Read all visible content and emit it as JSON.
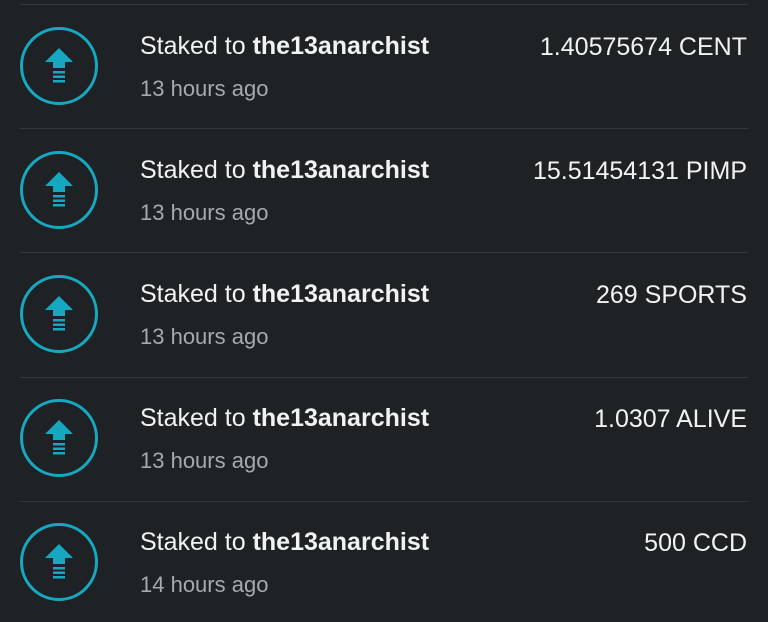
{
  "accent_color": "#17a7c0",
  "transactions": [
    {
      "action": "Staked to ",
      "user": "the13anarchist",
      "time": "13 hours ago",
      "amount": "1.40575674 CENT",
      "icon": "stake-arrow-up-icon"
    },
    {
      "action": "Staked to ",
      "user": "the13anarchist",
      "time": "13 hours ago",
      "amount": "15.51454131 PIMP",
      "icon": "stake-arrow-up-icon"
    },
    {
      "action": "Staked to ",
      "user": "the13anarchist",
      "time": "13 hours ago",
      "amount": "269 SPORTS",
      "icon": "stake-arrow-up-icon"
    },
    {
      "action": "Staked to ",
      "user": "the13anarchist",
      "time": "13 hours ago",
      "amount": "1.0307 ALIVE",
      "icon": "stake-arrow-up-icon"
    },
    {
      "action": "Staked to ",
      "user": "the13anarchist",
      "time": "14 hours ago",
      "amount": "500 CCD",
      "icon": "stake-arrow-up-icon"
    }
  ]
}
